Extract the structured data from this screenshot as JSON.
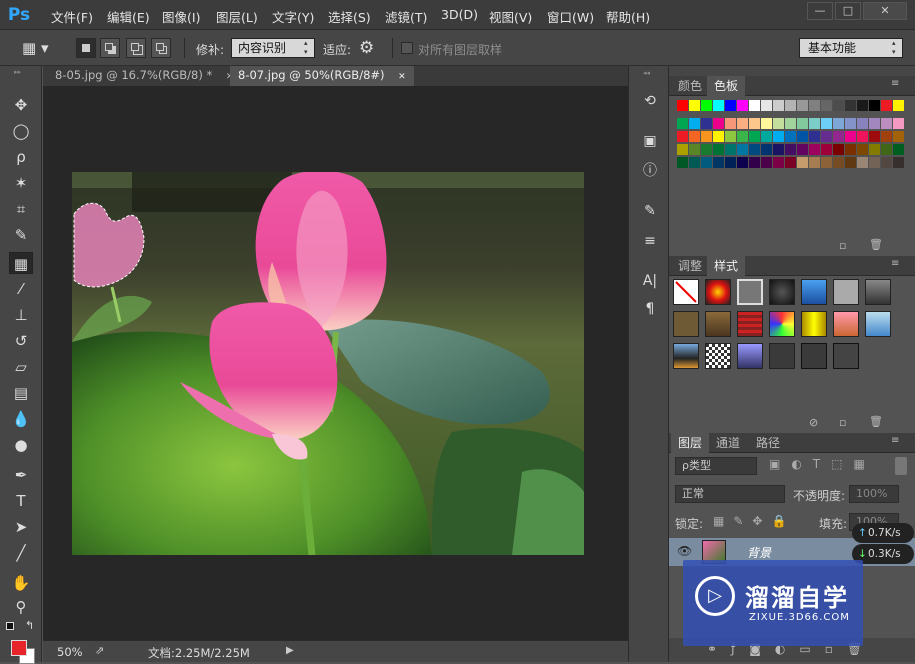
{
  "app": {
    "logo": "Ps"
  },
  "menu": [
    "文件(F)",
    "编辑(E)",
    "图像(I)",
    "图层(L)",
    "文字(Y)",
    "选择(S)",
    "滤镜(T)",
    "3D(D)",
    "视图(V)",
    "窗口(W)",
    "帮助(H)"
  ],
  "window_controls": {
    "minimize": "—",
    "maximize": "□",
    "close": "✕"
  },
  "options": {
    "patch_label": "修补:",
    "patch_value": "内容识别",
    "adapt_label": "适应:",
    "sample_all_label": "对所有图层取样",
    "workspace": "基本功能"
  },
  "tabs": [
    {
      "label": "8-05.jpg @ 16.7%(RGB/8) *",
      "close": "✕",
      "active": false
    },
    {
      "label": "8-07.jpg @ 50%(RGB/8#)",
      "close": "✕",
      "active": true
    }
  ],
  "status": {
    "zoom": "50%",
    "doc": "文档:2.25M/2.25M"
  },
  "panels": {
    "color_tabs": [
      "颜色",
      "色板"
    ],
    "adjust_tabs": [
      "调整",
      "样式"
    ],
    "layer_tabs": [
      "图层",
      "通道",
      "路径"
    ],
    "layer_filter": "ρ类型",
    "blend_mode": "正常",
    "opacity_label": "不透明度:",
    "opacity_value": "100%",
    "lock_label": "锁定:",
    "fill_label": "填充:",
    "fill_value": "100%",
    "layer_name": "背景"
  },
  "network": {
    "up": "0.7K/s",
    "down": "0.3K/s"
  },
  "watermark": {
    "title": "溜溜自学",
    "url": "ZIXUE.3D66.COM"
  },
  "swatches": {
    "row1": [
      "#ff0000",
      "#ffff00",
      "#00ff00",
      "#00ffff",
      "#0000ff",
      "#ff00ff",
      "#ffffff",
      "#e6e6e6",
      "#cccccc",
      "#b3b3b3",
      "#999999",
      "#808080",
      "#666666",
      "#4d4d4d",
      "#333333",
      "#1a1a1a",
      "#000000",
      "#ed1c24",
      "#fff200"
    ],
    "row2": [
      "#00a651",
      "#00aeef",
      "#2e3192",
      "#ec008c",
      "#f7977a",
      "#f9ad81",
      "#fdc68a",
      "#fff79a",
      "#c4df9b",
      "#a3d39c",
      "#82ca9d",
      "#7bcdc8",
      "#6ecff6",
      "#7ea7d8",
      "#8493ca",
      "#8882be",
      "#a187be",
      "#bc8dbf",
      "#f49ac2"
    ],
    "row3": [
      "#ed1c24",
      "#f26522",
      "#f7941d",
      "#fff200",
      "#8dc63f",
      "#39b54a",
      "#00a651",
      "#00a99d",
      "#00aeef",
      "#0072bc",
      "#0054a6",
      "#2e3192",
      "#662d91",
      "#92278f",
      "#ec008c",
      "#ed145b",
      "#9e0b0f",
      "#a0410d",
      "#a36209"
    ],
    "row4": [
      "#aba000",
      "#598527",
      "#1a7b30",
      "#007236",
      "#00746b",
      "#0076a3",
      "#004a80",
      "#003471",
      "#1b1464",
      "#440e62",
      "#630460",
      "#9e005d",
      "#9e0039",
      "#790000",
      "#7b2e00",
      "#7d4900",
      "#827b00",
      "#406618",
      "#005e20"
    ],
    "row5": [
      "#005826",
      "#005952",
      "#005b7f",
      "#003663",
      "#002157",
      "#0d004c",
      "#32004b",
      "#4b0049",
      "#7b0046",
      "#7a0026",
      "#c69c6d",
      "#a67c52",
      "#8c6239",
      "#754c24",
      "#603913",
      "#998675",
      "#736357",
      "#534741",
      "#362f2d"
    ]
  }
}
